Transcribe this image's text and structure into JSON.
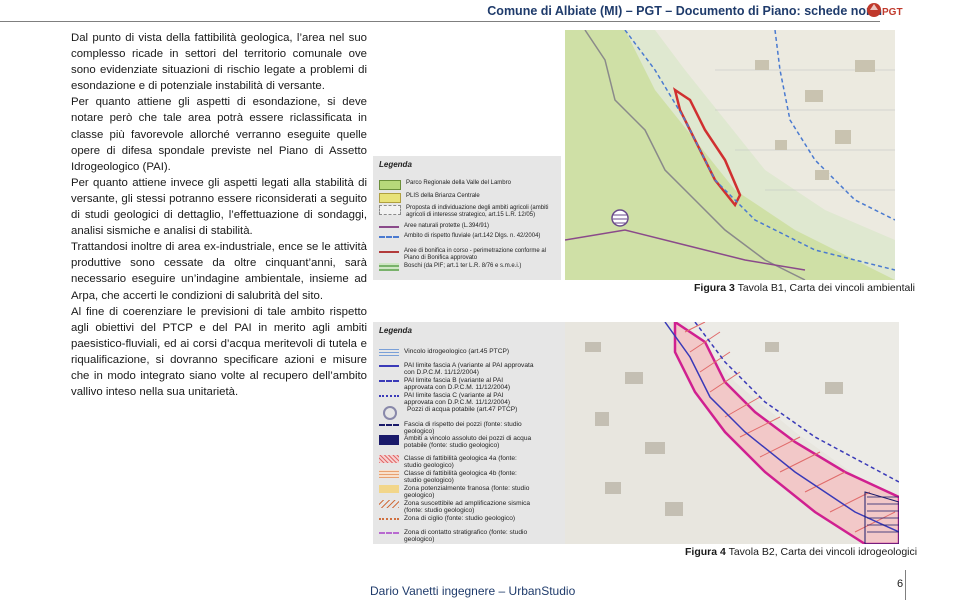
{
  "header": {
    "title": "Comune di Albiate (MI) – PGT – Documento di Piano: schede norm",
    "logo_text": "PGT"
  },
  "paragraphs": [
    "Dal punto di vista della fattibilità geologica, l’area nel suo complesso ricade in settori del territorio comunale ove sono evidenziate situazioni di rischio legate a problemi di esondazione e di potenziale instabilità di versante.",
    "Per quanto attiene gli aspetti di esondazione, si deve notare però che tale area potrà essere riclassificata in classe più favorevole allorché verranno eseguite quelle opere di difesa spondale previste nel Piano di Assetto Idrogeologico (PAI).",
    "Per quanto attiene invece gli aspetti legati alla stabilità di versante, gli stessi potranno essere riconsiderati a seguito di studi geologici di dettaglio, l’effettuazione di sondaggi, analisi sismiche e analisi di stabilità.",
    "Trattandosi inoltre di area ex-industriale, ence se le attività produttive sono cessate da oltre cinquant’anni, sarà necessario eseguire un’indagine ambientale, insieme ad Arpa, che accerti le condizioni di salubrità del sito.",
    "Al fine di coerenziare le previsioni di tale ambito rispetto agli obiettivi del PTCP e del PAI in merito agli ambiti paesistico-fluviali, ed ai corsi d’acqua meritevoli di tutela e riqualificazione, si dovranno specificare azioni e misure che in modo integrato siano volte al recupero dell’ambito vallivo inteso nella sua unitarietà."
  ],
  "legend1": {
    "title": "Legenda",
    "items": [
      {
        "label": "Parco Regionale della Valle del Lambro",
        "color": "#b7d87a"
      },
      {
        "label": "PLIS della Brianza Centrale",
        "color": "#e8e27a"
      },
      {
        "label": "Proposta di individuazione degli ambiti agricoli (ambiti agricoli di interesse strategico, art.15 L.R. 12/05)",
        "color": "#f2f2f2"
      },
      {
        "label": "Aree naturali protette (L.394/91)",
        "color": "#8a4a8a"
      },
      {
        "label": "Ambito di rispetto fluviale (art.142 Dlgs. n. 42/2004)",
        "color": "#4a7ad0"
      },
      {
        "label": "Aree di bonifica in corso - perimetrazione conforme al Piano di Bonifica approvato",
        "color": "#b23a3a"
      },
      {
        "label": "Boschi (da PIF; art.1 ter L.R. 8/76 e s.m.e.i.)",
        "color": "#79b26b"
      }
    ]
  },
  "legend2": {
    "title": "Legenda",
    "items": [
      {
        "label": "Vincolo idrogeologico (art.45 PTCP)",
        "color": "#7aa0d8"
      },
      {
        "label": "PAI limite fascia A (variante al PAI approvata con D.P.C.M. 11/12/2004)",
        "color": "#3a3ab8"
      },
      {
        "label": "PAI limite fascia B (variante al PAI approvata con D.P.C.M. 11/12/2004)",
        "color": "#3a3ab8"
      },
      {
        "label": "PAI limite fascia C (variante al PAI approvata con D.P.C.M. 11/12/2004)",
        "color": "#3a3ab8"
      },
      {
        "label": "Pozzi di acqua potabile (art.47 PTCP)",
        "color": "#8888aa"
      },
      {
        "label": "Fascia di rispetto dei pozzi (fonte: studio geologico)",
        "color": "#1a1a6a"
      },
      {
        "label": "Ambiti a vincolo assoluto dei pozzi di acqua potabile (fonte: studio geologico)",
        "color": "#1a1a6a"
      },
      {
        "label": "Classe di fattibilità geologica 4a (fonte: studio geologico)",
        "color": "#e06a6a"
      },
      {
        "label": "Classe di fattibilità geologica 4b (fonte: studio geologico)",
        "color": "#e8a070"
      },
      {
        "label": "Zona potenzialmente franosa (fonte: studio geologico)",
        "color": "#f2d68a"
      },
      {
        "label": "Zona suscettibile ad amplificazione sismica (fonte: studio geologico)",
        "color": "#c8c8c8"
      },
      {
        "label": "Zona di ciglio (fonte: studio geologico)",
        "color": "#d07040"
      },
      {
        "label": "Zona di contatto stratigrafico (fonte: studio geologico)",
        "color": "#b86ad0"
      }
    ]
  },
  "figures": [
    {
      "label": "Figura 3",
      "text": "Tavola B1, Carta dei vincoli ambientali"
    },
    {
      "label": "Figura 4",
      "text": "Tavola B2, Carta dei vincoli idrogeologici"
    }
  ],
  "footer": {
    "author": "Dario Vanetti ingegnere – UrbanStudio",
    "page": "6"
  }
}
